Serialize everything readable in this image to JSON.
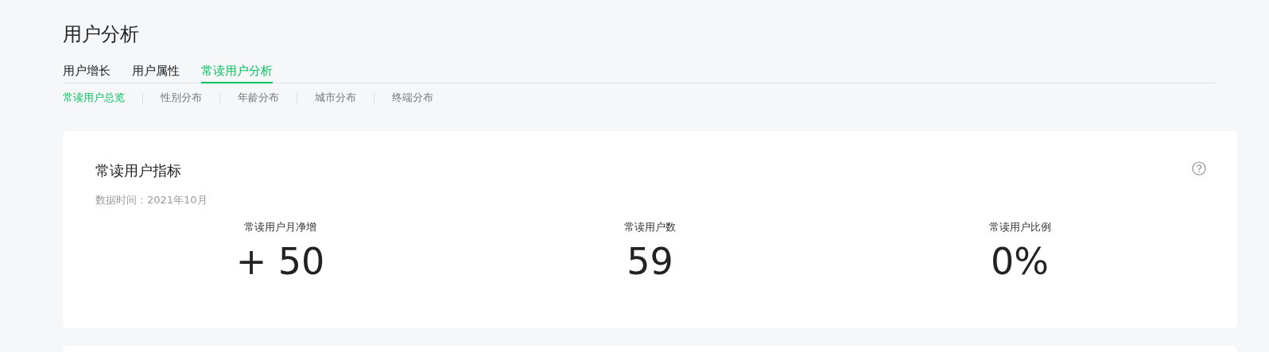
{
  "page": {
    "title": "用户分析"
  },
  "tabs": [
    {
      "label": "用户增长",
      "selected": false
    },
    {
      "label": "用户属性",
      "selected": false
    },
    {
      "label": "常读用户分析",
      "selected": true
    }
  ],
  "subtabs": [
    {
      "label": "常读用户总览",
      "selected": true
    },
    {
      "label": "性别分布",
      "selected": false
    },
    {
      "label": "年龄分布",
      "selected": false
    },
    {
      "label": "城市分布",
      "selected": false
    },
    {
      "label": "终端分布",
      "selected": false
    }
  ],
  "card": {
    "title": "常读用户指标",
    "data_time": "数据时间：2021年10月",
    "metrics": [
      {
        "label": "常读用户月净增",
        "value": "+ 50"
      },
      {
        "label": "常读用户数",
        "value": "59"
      },
      {
        "label": "常读用户比例",
        "value": "0%"
      }
    ]
  }
}
